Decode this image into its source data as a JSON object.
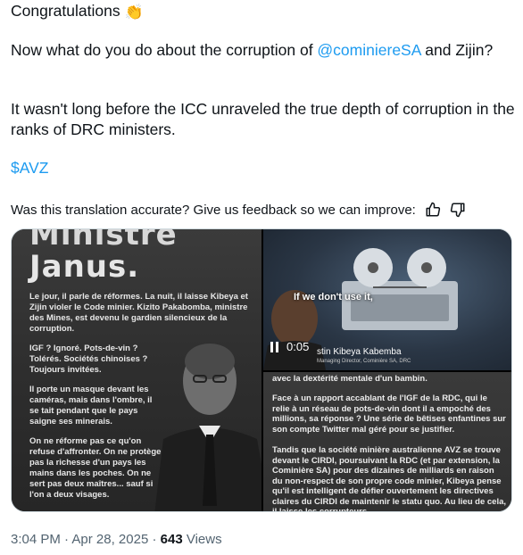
{
  "tweet": {
    "line1_text": "Congratulations",
    "line1_emoji_icon": "clapping-hands-icon",
    "para2_before": "Now what do you do about the corruption of ",
    "para2_mention": "@cominiereSA",
    "para2_after": " and Zijin?",
    "para3": "It wasn't long before the ICC unraveled the true depth of corruption in the ranks of DRC ministers.",
    "cashtag": "$AVZ"
  },
  "feedback": {
    "prompt": "Was this translation accurate? Give us feedback so we can improve:",
    "thumbs_up_icon": "thumbs-up-icon",
    "thumbs_down_icon": "thumbs-down-icon"
  },
  "media": {
    "left_image": {
      "title_top": "Ministre",
      "title": "Janus.",
      "body1": "Le jour, il parle de réformes. La nuit, il laisse Kibeya et Zijin violer le Code minier. Kizito Pakabomba, ministre des Mines, est devenu le gardien silencieux de la corruption.",
      "body2": "IGF ? Ignoré. Pots-de-vin ? Tolérés. Sociétés chinoises ? Toujours invitées.",
      "body3": "Il porte un masque devant les caméras, mais dans l'ombre, il se tait pendant que le pays saigne ses minerais.",
      "body4": "On ne réforme pas ce qu'on refuse d'affronter. On ne protège pas la richesse d'un pays les mains dans les poches. On ne sert pas deux maîtres... sauf si l'on a deux visages."
    },
    "video": {
      "caption": "If we don't use it,",
      "time": "0:05",
      "name": "stin Kibeya Kabemba",
      "role": "Managing Director, Cominière SA, DRC"
    },
    "right_bottom_image": {
      "text1": "avec la dextérité mentale d'un bambin.",
      "text2": "Face à un rapport accablant de l'IGF de la RDC, qui le relie à un réseau de pots-de-vin dont il a empoché des millions, sa réponse ? Une série de bêtises enfantines sur son compte Twitter mal géré pour se justifier.",
      "text3": "Tandis que la société minière australienne AVZ se trouve devant le CIRDI, poursuivant la RDC (et par extension, la Cominière SA) pour des dizaines de milliards en raison du non-respect de son propre code minier, Kibeya pense qu'il est intelligent de défier ouvertement les directives claires du CIRDI de maintenir le statu quo. Au lieu de cela, il laisse les corrupteurs"
    }
  },
  "meta": {
    "time": "3:04 PM",
    "separator": "·",
    "date": "Apr 28, 2025",
    "views_count": "643",
    "views_label": "Views"
  },
  "colors": {
    "link": "#1d9bf0",
    "text": "#0f1419",
    "muted": "#536471"
  }
}
